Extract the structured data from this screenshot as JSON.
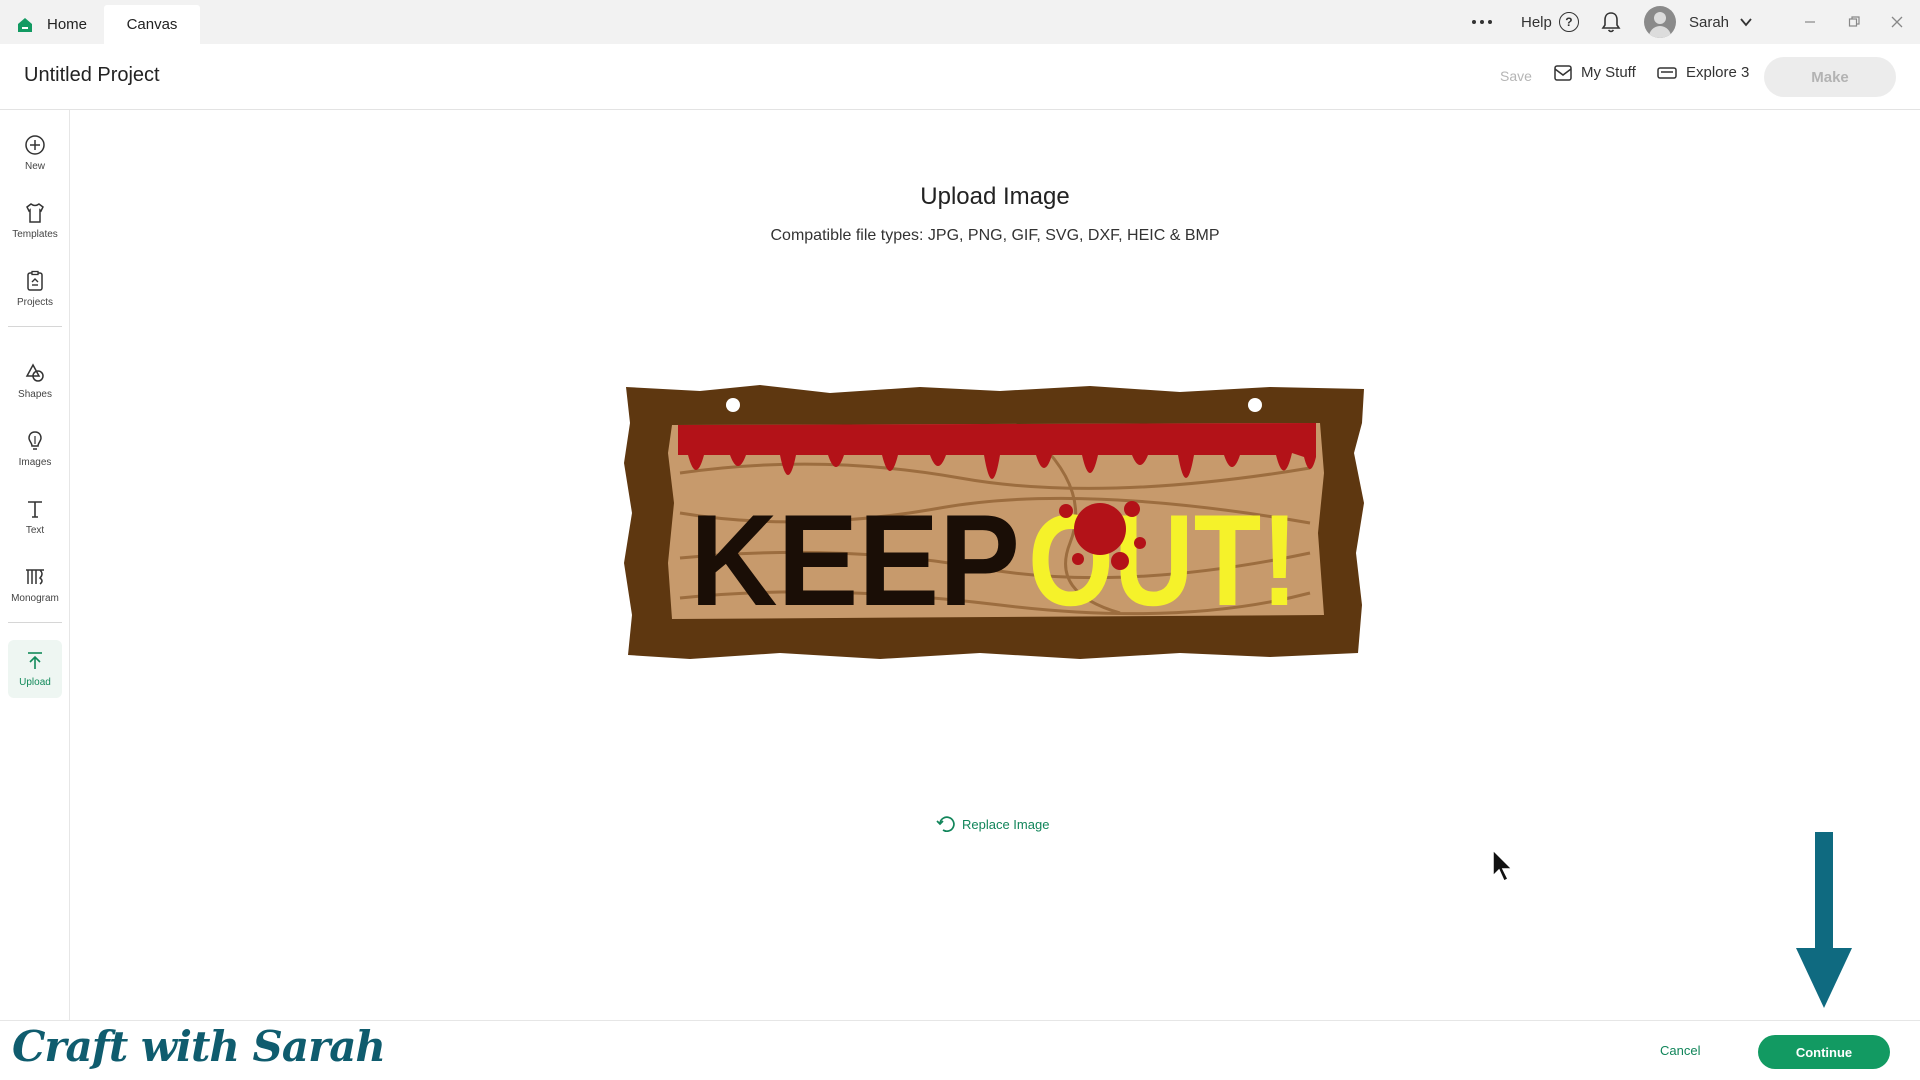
{
  "tabs": [
    {
      "label": "Home"
    },
    {
      "label": "Canvas"
    }
  ],
  "topbar": {
    "help_label": "Help",
    "help_glyph": "?",
    "user_name": "Sarah"
  },
  "header": {
    "project_title": "Untitled Project",
    "save_label": "Save",
    "mystuff_label": "My Stuff",
    "machine_label": "Explore 3",
    "make_label": "Make"
  },
  "sidebar": {
    "items": [
      {
        "label": "New",
        "icon": "plus-circle-icon"
      },
      {
        "label": "Templates",
        "icon": "shirt-icon"
      },
      {
        "label": "Projects",
        "icon": "clipboard-icon"
      },
      {
        "label": "Shapes",
        "icon": "shapes-icon"
      },
      {
        "label": "Images",
        "icon": "bulb-icon"
      },
      {
        "label": "Text",
        "icon": "text-t-icon"
      },
      {
        "label": "Monogram",
        "icon": "monogram-icon"
      },
      {
        "label": "Upload",
        "icon": "upload-icon"
      }
    ]
  },
  "main": {
    "title": "Upload Image",
    "subtitle": "Compatible file types:  JPG, PNG, GIF, SVG, DXF, HEIC & BMP",
    "preview_text_left": "KEEP",
    "preview_text_right": "OUT!",
    "replace_label": "Replace Image"
  },
  "footer": {
    "cancel_label": "Cancel",
    "continue_label": "Continue",
    "watermark": "Craft with Sarah"
  },
  "colors": {
    "accent": "#129a62",
    "annotation_arrow": "#0f6a80",
    "wood_frame": "#5e3710",
    "blood": "#b31218",
    "keep_text": "#1a0e06",
    "out_text": "#f5f22a"
  }
}
